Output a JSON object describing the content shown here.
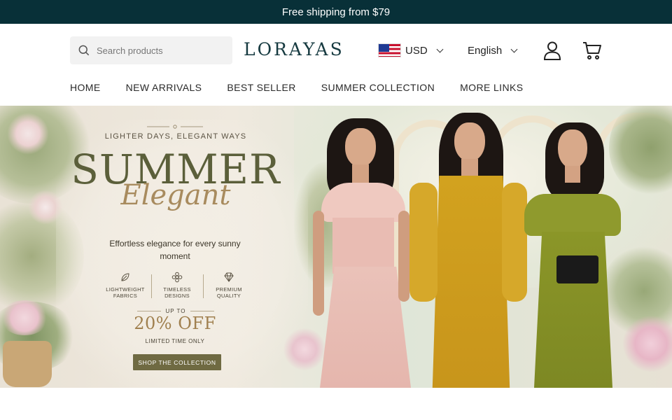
{
  "announcement": {
    "text": "Free shipping from $79"
  },
  "header": {
    "search": {
      "placeholder": "Search products",
      "value": ""
    },
    "logo": "LORAYAS",
    "currency": {
      "flag": "us-flag-icon",
      "code": "USD"
    },
    "language": "English",
    "icons": [
      "search-icon",
      "account-icon",
      "cart-icon",
      "chevron-down-icon"
    ]
  },
  "nav": {
    "items": [
      {
        "label": "HOME"
      },
      {
        "label": "NEW ARRIVALS"
      },
      {
        "label": "BEST SELLER"
      },
      {
        "label": "SUMMER COLLECTION"
      },
      {
        "label": "MORE LINKS"
      }
    ]
  },
  "hero": {
    "eyebrow": "LIGHTER DAYS, ELEGANT WAYS",
    "headline": "SUMMER",
    "script": "Elegant",
    "tagline": "Effortless elegance for every sunny moment",
    "features": [
      {
        "icon": "leaf-icon",
        "label": "LIGHTWEIGHT FABRICS"
      },
      {
        "icon": "flower-icon",
        "label": "TIMELESS DESIGNS"
      },
      {
        "icon": "diamond-icon",
        "label": "PREMIUM QUALITY"
      }
    ],
    "upto": "UP TO",
    "offer": "20% OFF",
    "limited": "LIMITED TIME ONLY",
    "cta": "SHOP THE COLLECTION"
  },
  "colors": {
    "announcement_bg": "#083038",
    "logo": "#163a40",
    "cta_bg": "#6f6a42",
    "headline": "#5b5f3a",
    "accent_gold": "#a88b5e"
  }
}
